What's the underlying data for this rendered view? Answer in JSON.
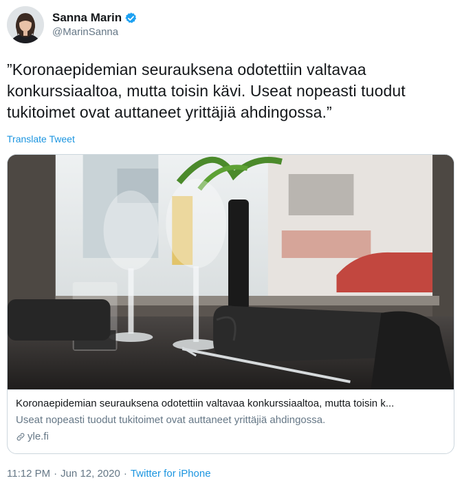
{
  "author": {
    "display_name": "Sanna Marin",
    "handle": "@MarinSanna",
    "verified": true
  },
  "tweet": {
    "text": "”Koronaepidemian seurauksena odotettiin valtavaa konkurssiaaltoa, mutta toisin kävi. Useat nopeasti tuodut tukitoimet ovat auttaneet yrittäjiä ahdingossa.”",
    "translate_label": "Translate Tweet"
  },
  "card": {
    "title": "Koronaepidemian seurauksena odotettiin valtavaa konkurssiaaltoa, mutta toisin k...",
    "description": "Useat nopeasti tuodut tukitoimet ovat auttaneet yrittäjiä ahdingossa.",
    "domain": "yle.fi",
    "domain_icon": "link-icon",
    "image_icon": "restaurant-table-photo"
  },
  "meta": {
    "time": "11:12 PM",
    "separator": "·",
    "date": "Jun 12, 2020",
    "source": "Twitter for iPhone"
  },
  "colors": {
    "link_blue": "#1b95e0",
    "muted_gray": "#657786",
    "text": "#14171a",
    "border": "#ccd6dd",
    "verified_blue": "#1da1f2"
  }
}
